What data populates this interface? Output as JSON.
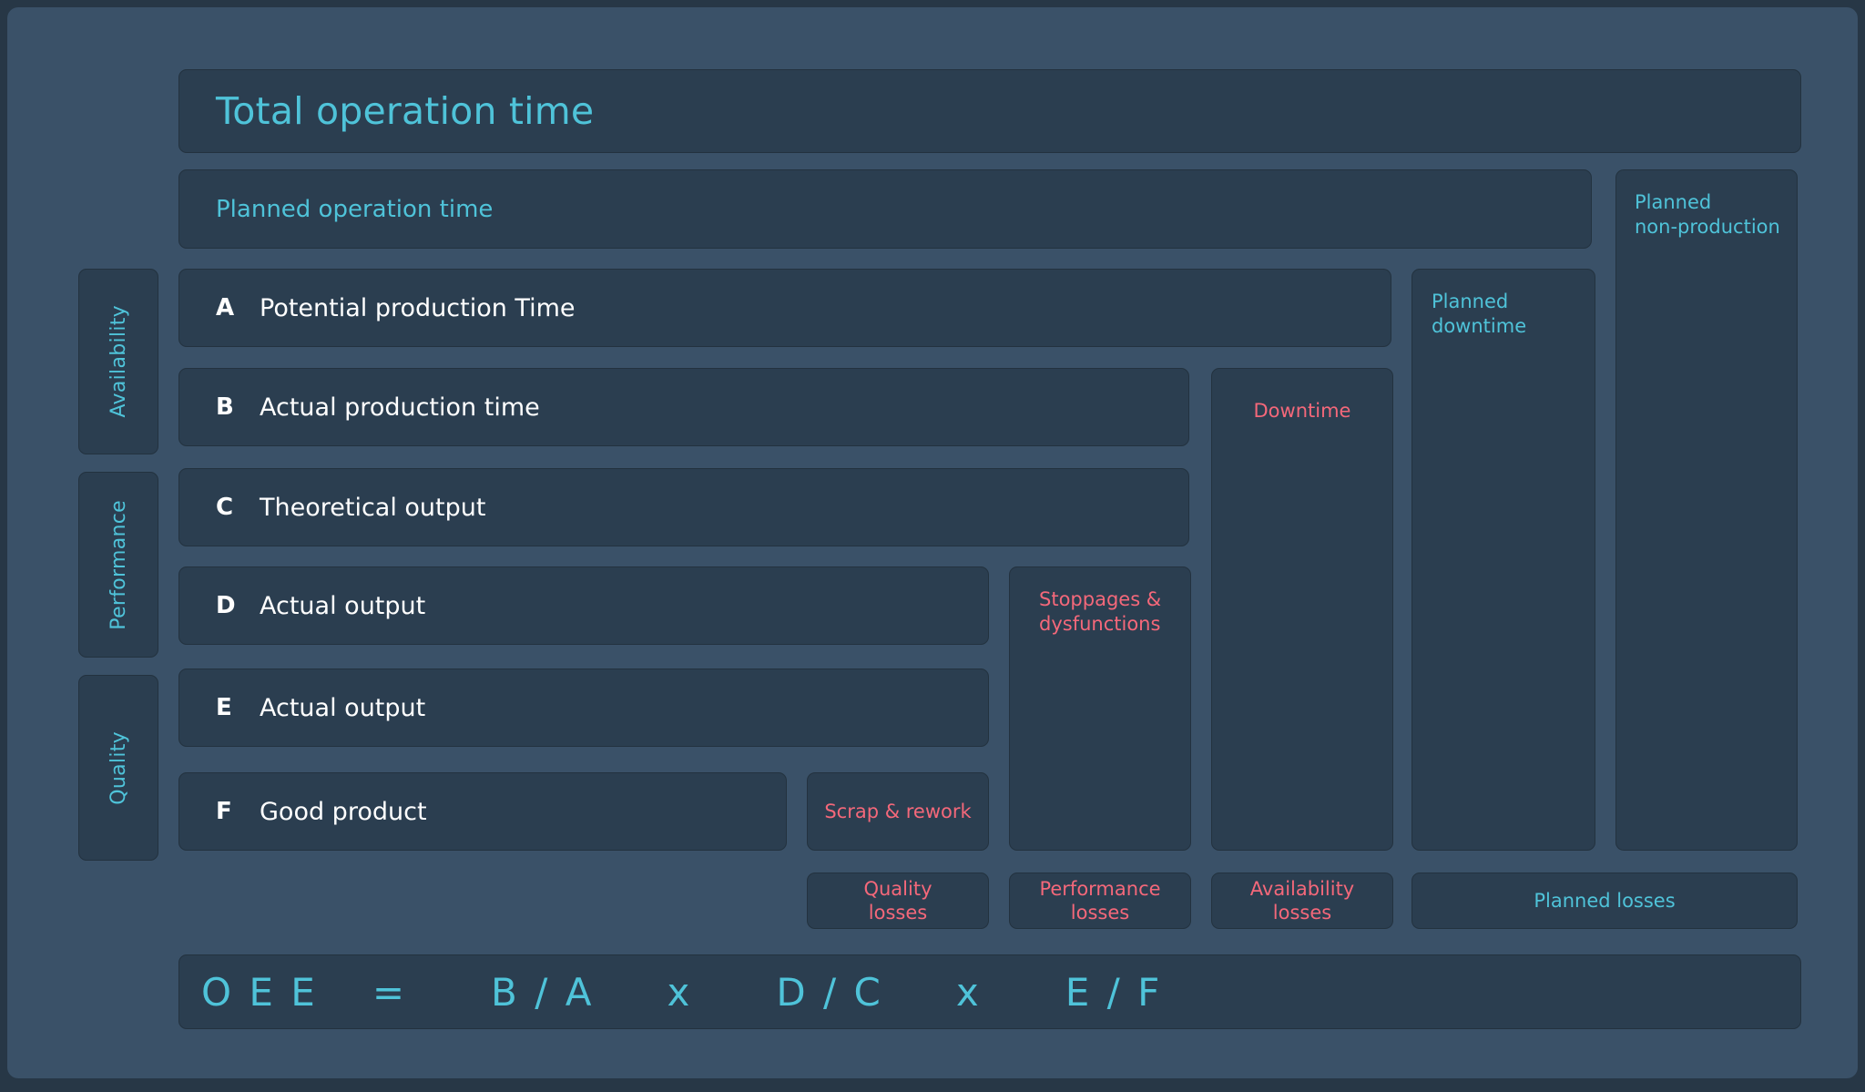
{
  "diagram": {
    "title": "Total operation time",
    "planned_operation_time": "Planned operation time",
    "planned_non_production": "Planned\nnon-production",
    "planned_non_production_line1": "Planned",
    "planned_non_production_line2": "non-production",
    "planned_downtime_line1": "Planned",
    "planned_downtime_line2": "downtime",
    "downtime": "Downtime",
    "stoppages_line1": "Stoppages &",
    "stoppages_line2": "dysfunctions",
    "scrap_rework": "Scrap & rework"
  },
  "categories": [
    {
      "key": "availability",
      "label": "Availability"
    },
    {
      "key": "performance",
      "label": "Performance"
    },
    {
      "key": "quality",
      "label": "Quality"
    }
  ],
  "rows": [
    {
      "letter": "A",
      "label": "Potential production Time"
    },
    {
      "letter": "B",
      "label": "Actual production time"
    },
    {
      "letter": "C",
      "label": "Theoretical output"
    },
    {
      "letter": "D",
      "label": "Actual output"
    },
    {
      "letter": "E",
      "label": "Actual output"
    },
    {
      "letter": "F",
      "label": "Good product"
    }
  ],
  "losses": [
    {
      "key": "quality",
      "line1": "Quality",
      "line2": "losses"
    },
    {
      "key": "performance",
      "line1": "Performance",
      "line2": "losses"
    },
    {
      "key": "availability",
      "line1": "Availability",
      "line2": "losses"
    },
    {
      "key": "planned",
      "line1": "Planned losses",
      "line2": ""
    }
  ],
  "formula": {
    "name": "O E E",
    "equals": "=",
    "term1": "B / A",
    "op1": "x",
    "term2": "D / C",
    "op2": "x",
    "term3": "E / F",
    "full": "OEE = B/A x D/C x E/F"
  },
  "colors": {
    "page_background": "#273746",
    "canvas_background": "#3a5168",
    "box_background": "#2b3e50",
    "box_border": "#23323f",
    "accent_cyan": "#4fc3d9",
    "accent_coral": "#f4687a",
    "text_white": "#ffffff"
  }
}
